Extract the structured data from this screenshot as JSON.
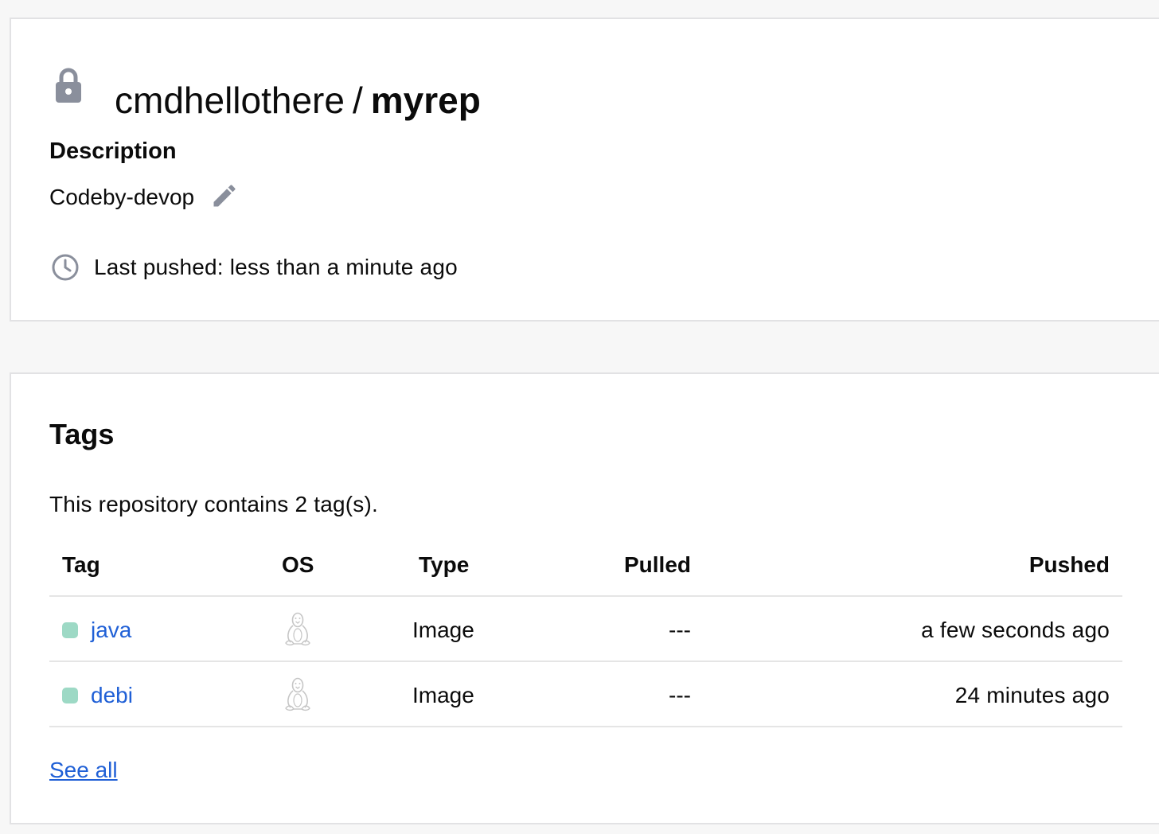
{
  "repo": {
    "namespace": "cmdhellothere",
    "separator": "/",
    "name": "myrep",
    "visibility_icon": "lock-icon"
  },
  "description": {
    "label": "Description",
    "text": "Codeby-devop",
    "edit_icon": "pencil-icon"
  },
  "last_pushed": {
    "icon": "clock-icon",
    "text": "Last pushed: less than a minute ago"
  },
  "tags": {
    "title": "Tags",
    "summary": "This repository contains 2 tag(s).",
    "columns": [
      "Tag",
      "OS",
      "Type",
      "Pulled",
      "Pushed"
    ],
    "rows": [
      {
        "tag": "java",
        "status_color": "#9dd9c5",
        "os_icon": "linux-icon",
        "type": "Image",
        "pulled": "---",
        "pushed": "a few seconds ago"
      },
      {
        "tag": "debi",
        "status_color": "#9dd9c5",
        "os_icon": "linux-icon",
        "type": "Image",
        "pulled": "---",
        "pushed": "24 minutes ago"
      }
    ],
    "see_all": "See all"
  },
  "colors": {
    "link": "#2060d6",
    "icon_gray": "#8a8f9c",
    "border": "#e2e2e4"
  }
}
